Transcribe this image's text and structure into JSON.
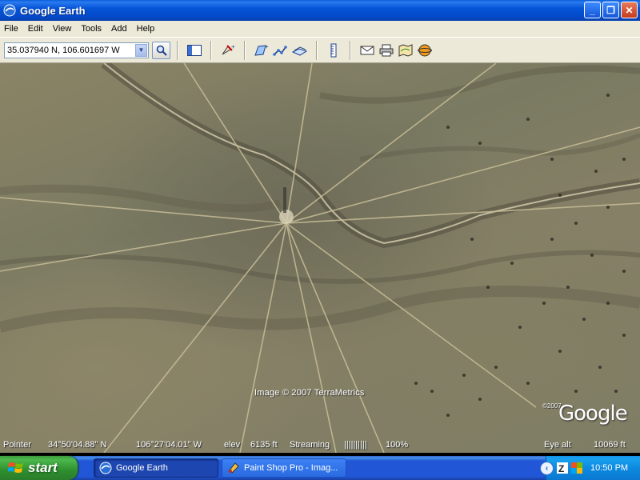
{
  "window": {
    "title": "Google Earth",
    "controls": {
      "minimize": "_",
      "maximize": "❐",
      "close": "✕"
    }
  },
  "menu": [
    "File",
    "Edit",
    "View",
    "Tools",
    "Add",
    "Help"
  ],
  "toolbar": {
    "search_value": "35.037940 N, 106.601697 W",
    "icons": [
      "sidebar-toggle-icon",
      "placemark-icon",
      "polygon-icon",
      "path-icon",
      "image-overlay-icon",
      "ruler-icon",
      "email-icon",
      "print-icon",
      "maps-icon",
      "sky-icon"
    ]
  },
  "map": {
    "copyright": "Image © 2007 TerraMetrics",
    "logo_small": "©2007",
    "logo": "Google"
  },
  "status": {
    "pointer_label": "Pointer",
    "latitude": "34°50'04.88\" N",
    "longitude": "106°27'04.01\" W",
    "elev_label": "elev",
    "elevation": "6135 ft",
    "streaming_label": "Streaming",
    "streaming_bar": "||||||||||",
    "streaming_percent": "100%",
    "eye_alt_label": "Eye alt",
    "eye_alt": "10069 ft"
  },
  "taskbar": {
    "start_label": "start",
    "tasks": [
      {
        "label": "Google Earth",
        "active": true
      },
      {
        "label": "Paint Shop Pro - Imag...",
        "active": false
      }
    ],
    "clock": "10:50 PM"
  },
  "colors": {
    "titlebar": "#0554d6",
    "menubar": "#ece9d8",
    "taskbar": "#2157d7",
    "start_button": "#3c9a3c",
    "terrain": "#868066"
  }
}
